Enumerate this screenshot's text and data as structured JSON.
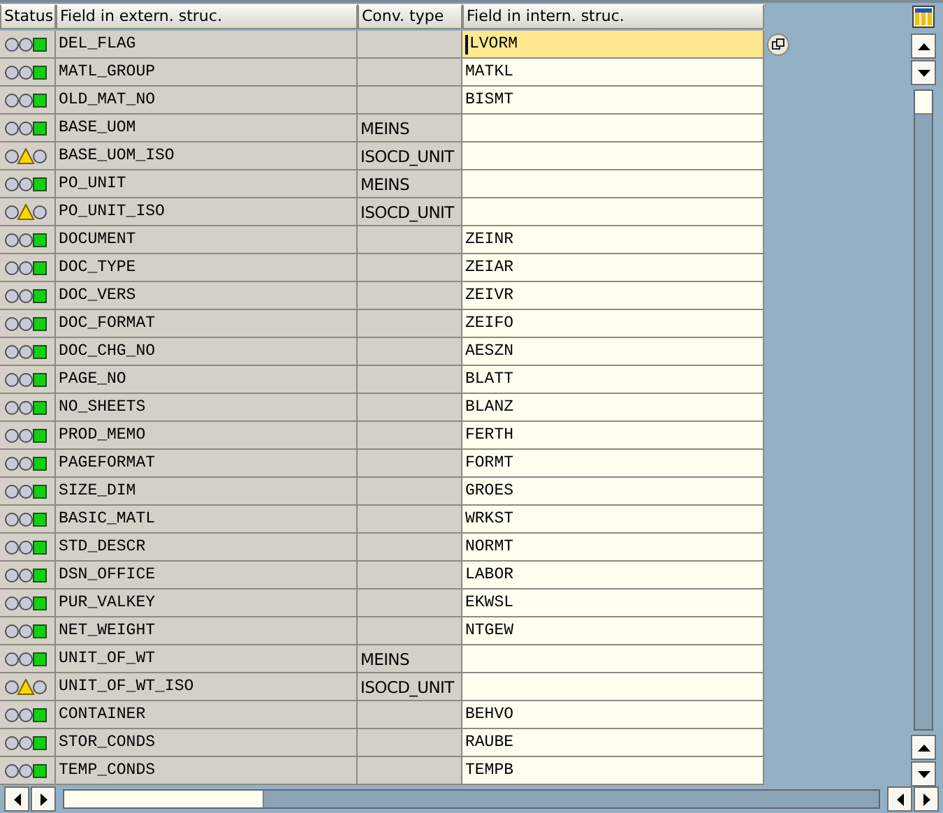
{
  "table": {
    "columns": [
      "Status",
      "Field in extern. struc.",
      "Conv. type",
      "Field in intern. struc."
    ],
    "rows": [
      {
        "kind": "ok",
        "external": "DEL_FLAG",
        "conv": "",
        "internal": "LVORM",
        "selected": true
      },
      {
        "kind": "ok",
        "external": "MATL_GROUP",
        "conv": "",
        "internal": "MATKL",
        "selected": false
      },
      {
        "kind": "ok",
        "external": "OLD_MAT_NO",
        "conv": "",
        "internal": "BISMT",
        "selected": false
      },
      {
        "kind": "ok",
        "external": "BASE_UOM",
        "conv": "MEINS",
        "internal": "",
        "selected": false
      },
      {
        "kind": "warning",
        "external": "BASE_UOM_ISO",
        "conv": "ISOCD_UNIT",
        "internal": "",
        "selected": false
      },
      {
        "kind": "ok",
        "external": "PO_UNIT",
        "conv": "MEINS",
        "internal": "",
        "selected": false
      },
      {
        "kind": "warning",
        "external": "PO_UNIT_ISO",
        "conv": "ISOCD_UNIT",
        "internal": "",
        "selected": false
      },
      {
        "kind": "ok",
        "external": "DOCUMENT",
        "conv": "",
        "internal": "ZEINR",
        "selected": false
      },
      {
        "kind": "ok",
        "external": "DOC_TYPE",
        "conv": "",
        "internal": "ZEIAR",
        "selected": false
      },
      {
        "kind": "ok",
        "external": "DOC_VERS",
        "conv": "",
        "internal": "ZEIVR",
        "selected": false
      },
      {
        "kind": "ok",
        "external": "DOC_FORMAT",
        "conv": "",
        "internal": "ZEIFO",
        "selected": false
      },
      {
        "kind": "ok",
        "external": "DOC_CHG_NO",
        "conv": "",
        "internal": "AESZN",
        "selected": false
      },
      {
        "kind": "ok",
        "external": "PAGE_NO",
        "conv": "",
        "internal": "BLATT",
        "selected": false
      },
      {
        "kind": "ok",
        "external": "NO_SHEETS",
        "conv": "",
        "internal": "BLANZ",
        "selected": false
      },
      {
        "kind": "ok",
        "external": "PROD_MEMO",
        "conv": "",
        "internal": "FERTH",
        "selected": false
      },
      {
        "kind": "ok",
        "external": "PAGEFORMAT",
        "conv": "",
        "internal": "FORMT",
        "selected": false
      },
      {
        "kind": "ok",
        "external": "SIZE_DIM",
        "conv": "",
        "internal": "GROES",
        "selected": false
      },
      {
        "kind": "ok",
        "external": "BASIC_MATL",
        "conv": "",
        "internal": "WRKST",
        "selected": false
      },
      {
        "kind": "ok",
        "external": "STD_DESCR",
        "conv": "",
        "internal": "NORMT",
        "selected": false
      },
      {
        "kind": "ok",
        "external": "DSN_OFFICE",
        "conv": "",
        "internal": "LABOR",
        "selected": false
      },
      {
        "kind": "ok",
        "external": "PUR_VALKEY",
        "conv": "",
        "internal": "EKWSL",
        "selected": false
      },
      {
        "kind": "ok",
        "external": "NET_WEIGHT",
        "conv": "",
        "internal": "NTGEW",
        "selected": false
      },
      {
        "kind": "ok",
        "external": "UNIT_OF_WT",
        "conv": "MEINS",
        "internal": "",
        "selected": false
      },
      {
        "kind": "warning",
        "external": "UNIT_OF_WT_ISO",
        "conv": "ISOCD_UNIT",
        "internal": "",
        "selected": false
      },
      {
        "kind": "ok",
        "external": "CONTAINER",
        "conv": "",
        "internal": "BEHVO",
        "selected": false
      },
      {
        "kind": "ok",
        "external": "STOR_CONDS",
        "conv": "",
        "internal": "RAUBE",
        "selected": false
      },
      {
        "kind": "ok",
        "external": "TEMP_CONDS",
        "conv": "",
        "internal": "TEMPB",
        "selected": false
      }
    ]
  }
}
